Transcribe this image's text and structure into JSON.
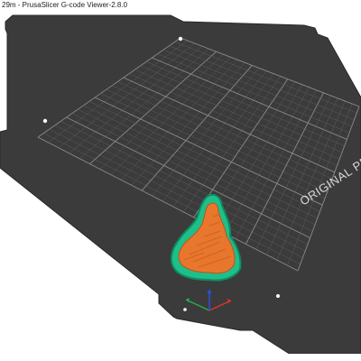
{
  "window": {
    "title": "29m - PrusaSlicer G-code Viewer-2.8.0"
  },
  "bed": {
    "label": "ORIGINAL PRUSA",
    "colors": {
      "plate": "#3b3b3b",
      "plate_edge": "#2a2a2a",
      "grid_minor": "#5c5c5c",
      "grid_major": "#8a8a8a",
      "label": "#d8d8d8"
    }
  },
  "print": {
    "colors": {
      "skirt": "#1fbf8a",
      "skirt_dark": "#0e8c66",
      "infill": "#e8762d",
      "infill_dark": "#b9551a"
    }
  },
  "axes": {
    "x_color": "#e03030",
    "y_color": "#22b24c",
    "z_color": "#2f4fd8",
    "icon": "axes-gizmo-icon"
  }
}
